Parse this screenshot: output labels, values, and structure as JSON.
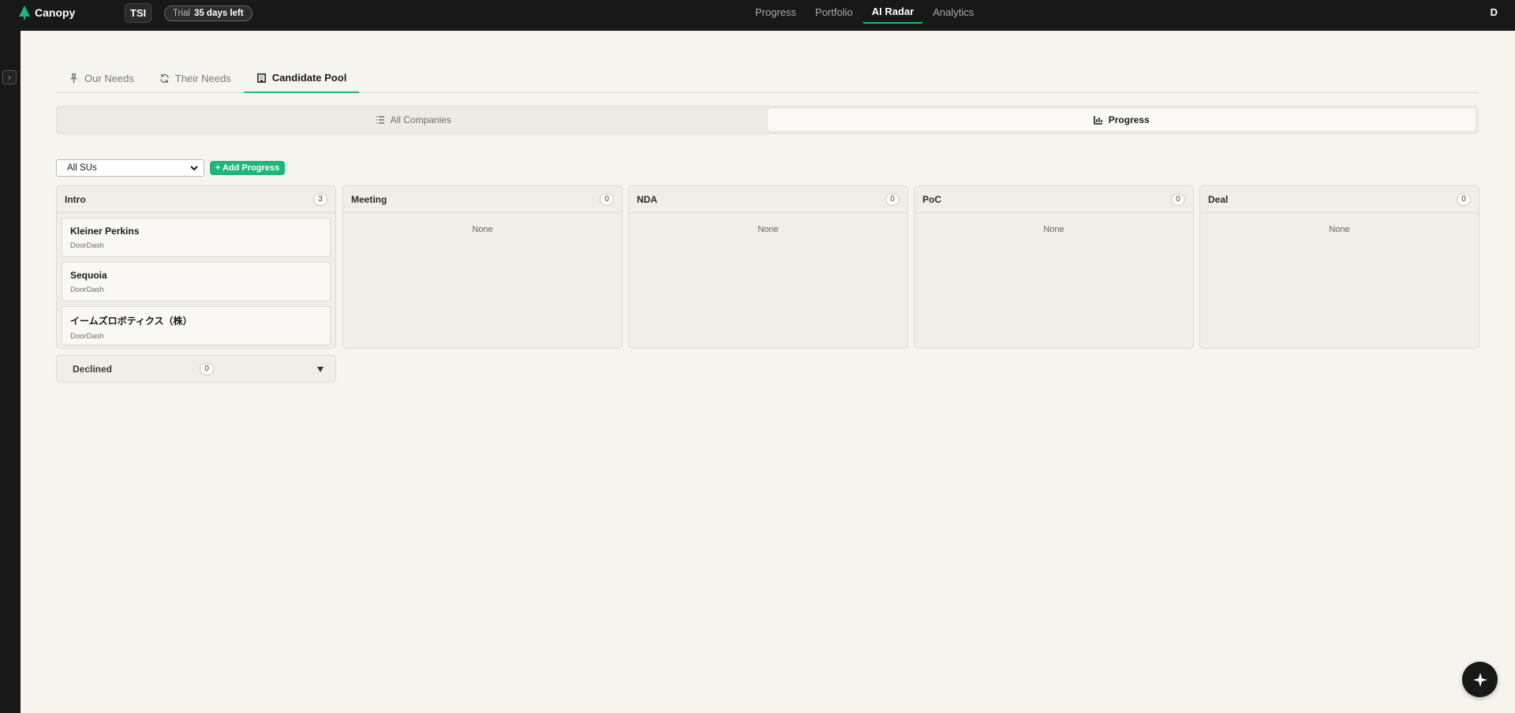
{
  "app": {
    "name": "Canopy",
    "org_badge": "TSI",
    "trial_label": "Trial",
    "trial_days": "35 days left",
    "user_initial": "D"
  },
  "topnav": [
    {
      "label": "Progress",
      "active": false
    },
    {
      "label": "Portfolio",
      "active": false
    },
    {
      "label": "AI Radar",
      "active": true
    },
    {
      "label": "Analytics",
      "active": false
    }
  ],
  "subtabs": [
    {
      "label": "Our Needs",
      "icon": "pin-icon",
      "active": false
    },
    {
      "label": "Their Needs",
      "icon": "refresh-icon",
      "active": false
    },
    {
      "label": "Candidate Pool",
      "icon": "building-icon",
      "active": true
    }
  ],
  "view_toggle": [
    {
      "label": "All Companies",
      "icon": "list-icon",
      "active": false
    },
    {
      "label": "Progress",
      "icon": "bar-chart-icon",
      "active": true
    }
  ],
  "filters": {
    "su_select": "All SUs",
    "add_progress_label": "+ Add Progress"
  },
  "board": {
    "empty_text": "None",
    "columns": [
      {
        "title": "Intro",
        "count": "3",
        "cards": [
          {
            "title": "Kleiner Perkins",
            "sub": "DoorDash"
          },
          {
            "title": "Sequoia",
            "sub": "DoorDash"
          },
          {
            "title": "イームズロボティクス（株）",
            "sub": "DoorDash"
          }
        ]
      },
      {
        "title": "Meeting",
        "count": "0",
        "cards": []
      },
      {
        "title": "NDA",
        "count": "0",
        "cards": []
      },
      {
        "title": "PoC",
        "count": "0",
        "cards": []
      },
      {
        "title": "Deal",
        "count": "0",
        "cards": []
      }
    ],
    "declined": {
      "label": "Declined",
      "count": "0"
    }
  },
  "colors": {
    "accent": "#1fb67a",
    "topbar": "#181818",
    "background": "#f6f4ef"
  }
}
